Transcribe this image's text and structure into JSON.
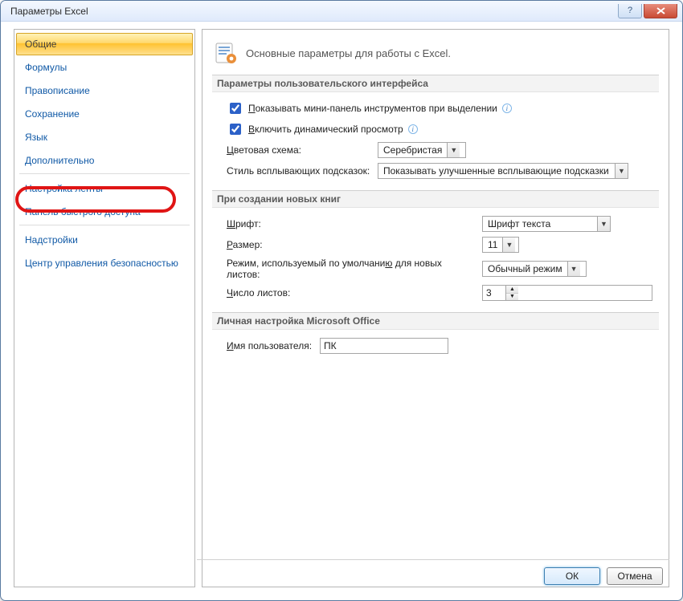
{
  "window": {
    "title": "Параметры Excel"
  },
  "sidebar": {
    "items": [
      "Общие",
      "Формулы",
      "Правописание",
      "Сохранение",
      "Язык",
      "Дополнительно",
      "Настройка ленты",
      "Панель быстрого доступа",
      "Надстройки",
      "Центр управления безопасностью"
    ],
    "selected_index": 0,
    "highlight_index": 7
  },
  "header": {
    "text": "Основные параметры для работы с Excel."
  },
  "group_ui": {
    "title": "Параметры пользовательского интерфейса",
    "mini_toolbar_label": "Показывать мини-панель инструментов при выделении",
    "live_preview_label": "Включить динамический просмотр",
    "color_scheme_label": "Цветовая схема:",
    "color_scheme_value": "Серебристая",
    "screentip_label": "Стиль всплывающих подсказок:",
    "screentip_value": "Показывать улучшенные всплывающие подсказки"
  },
  "group_new": {
    "title": "При создании новых книг",
    "font_label": "Шрифт:",
    "font_value": "Шрифт текста",
    "size_label": "Размер:",
    "size_value": "11",
    "view_label": "Режим, используемый по умолчанию для новых листов:",
    "view_value": "Обычный режим",
    "sheets_label": "Число листов:",
    "sheets_value": "3"
  },
  "group_personal": {
    "title": "Личная настройка Microsoft Office",
    "username_label": "Имя пользователя:",
    "username_value": "ПК"
  },
  "buttons": {
    "ok": "ОК",
    "cancel": "Отмена"
  }
}
